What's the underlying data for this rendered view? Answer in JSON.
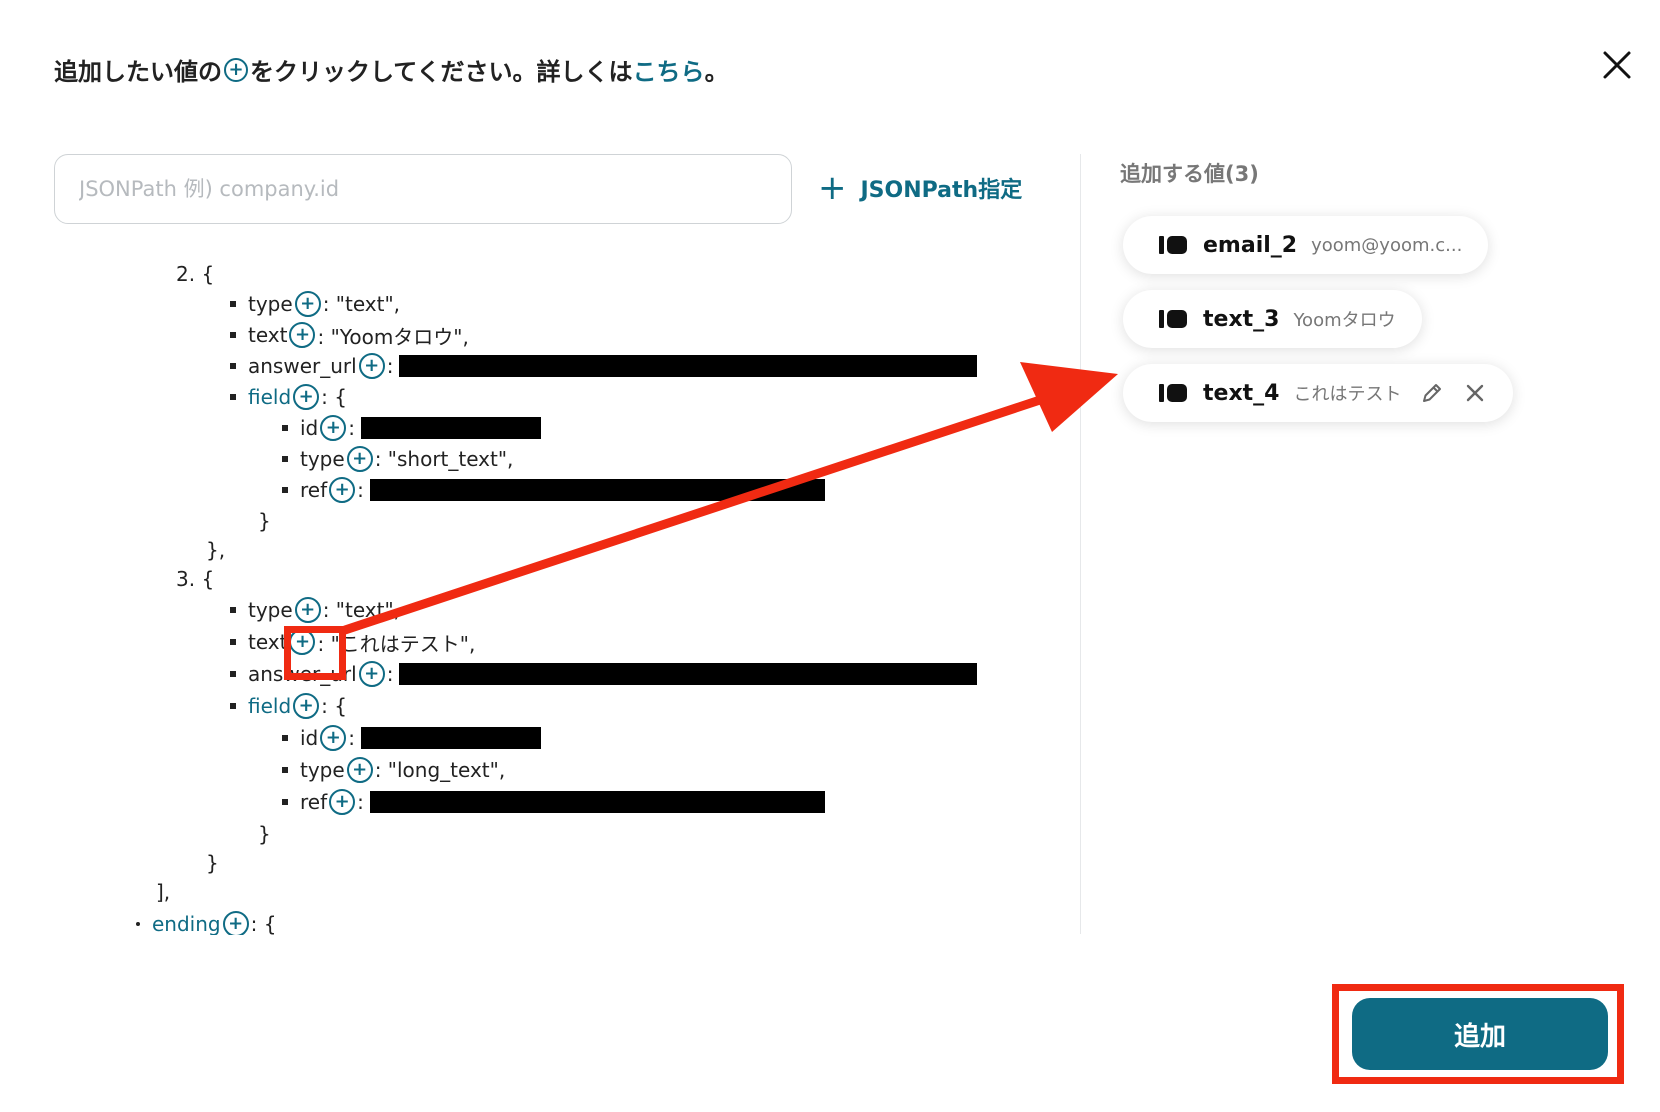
{
  "header": {
    "prefix": "追加したい値の",
    "plus_symbol": "+",
    "middle": "をクリックしてください。詳しくは",
    "link": "こちら",
    "suffix": "。"
  },
  "search": {
    "placeholder": "JSONPath 例) company.id",
    "value": ""
  },
  "jsonpath_button": {
    "label": "JSONPath指定",
    "plus": "+"
  },
  "tree": {
    "plus_symbol": "+",
    "lines": [
      "2. {",
      "type",
      ": \"text\",",
      "text",
      ": \"Yoomタロウ\",",
      "answer_url",
      ":",
      "field",
      ": {",
      "id",
      ":",
      "type",
      ": \"short_text\",",
      "ref",
      ":",
      "}",
      "},",
      "3. {",
      "type",
      ": \"text\",",
      "text",
      ": \"これはテスト\",",
      "answer_url",
      ":",
      "field",
      ": {",
      "id",
      ":",
      "type",
      ": \"long_text\",",
      "ref",
      ":",
      "}",
      "}",
      "],",
      "ending",
      ": {"
    ]
  },
  "panel": {
    "title": "追加する値(3)",
    "chips": [
      {
        "name": "email_2",
        "value": "yoom@yoom.c..."
      },
      {
        "name": "text_3",
        "value": "Yoomタロウ"
      },
      {
        "name": "text_4",
        "value": "これはテスト"
      }
    ]
  },
  "add_button": {
    "label": "追加"
  },
  "colors": {
    "accent": "#0f6b84",
    "highlight": "#f02a12",
    "redaction": "#000000"
  },
  "icons": [
    "close-icon",
    "plus-circle-icon",
    "plus-icon",
    "tag-icon",
    "pencil-icon",
    "remove-icon",
    "arrow-annotation"
  ]
}
